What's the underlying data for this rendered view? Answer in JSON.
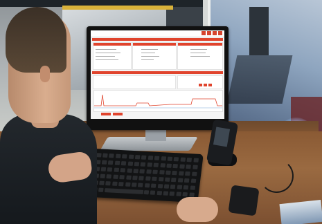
{
  "scene": {
    "description_free": true
  },
  "monitor_screen": {
    "logo_text": "",
    "title_text": "",
    "accent_color": "#e0442d"
  }
}
